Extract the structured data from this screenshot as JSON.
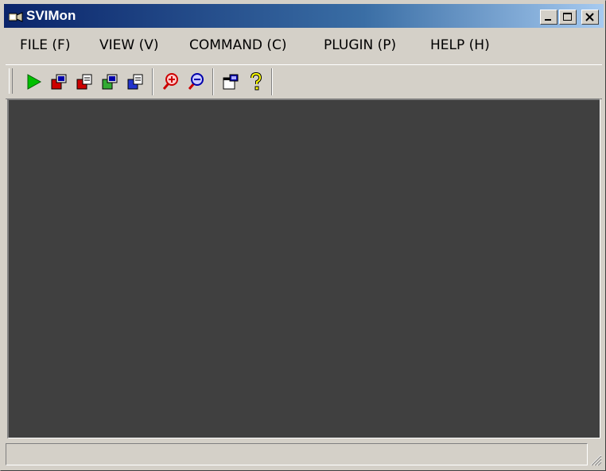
{
  "window": {
    "title": "SVIMon"
  },
  "menu": [
    {
      "label": "FILE (F)"
    },
    {
      "label": "VIEW (V)"
    },
    {
      "label": "COMMAND (C)"
    },
    {
      "label": "PLUGIN (P)"
    },
    {
      "label": "HELP (H)"
    }
  ],
  "toolbar": {
    "icons": [
      "play-icon",
      "connect-icon",
      "disconnect-icon",
      "connect-alt-icon",
      "disconnect-alt-icon",
      "zoom-in-icon",
      "zoom-out-icon",
      "properties-icon",
      "help-icon"
    ]
  },
  "colors": {
    "titlebar_start": "#0a246a",
    "client_bg": "#404040",
    "chrome": "#d4d0c8"
  }
}
